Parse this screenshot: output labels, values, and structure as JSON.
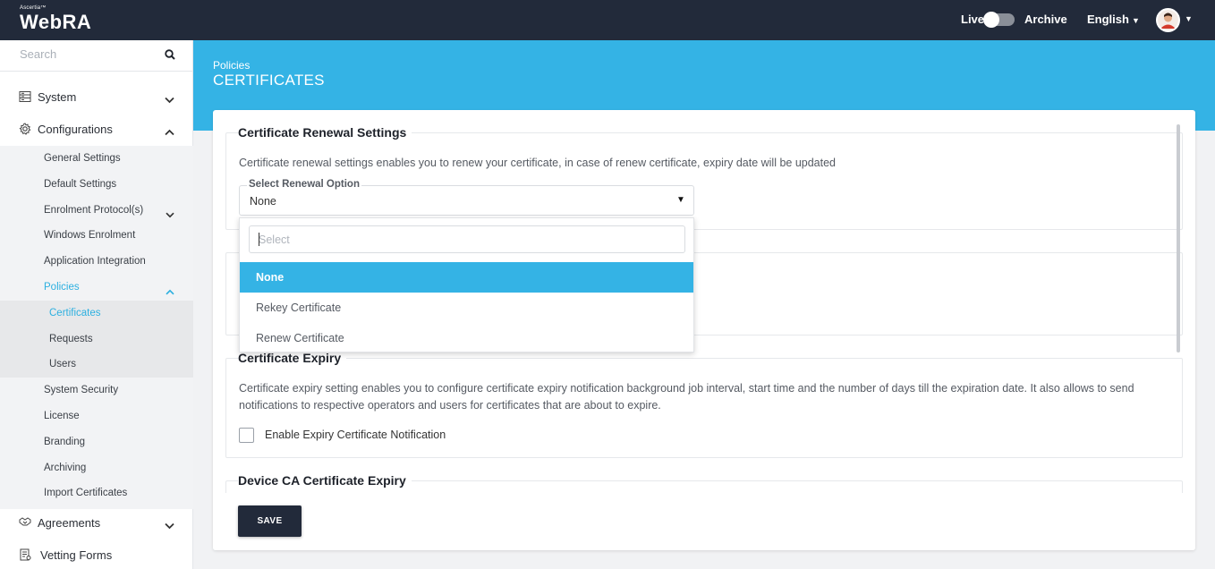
{
  "header": {
    "brand_sup": "Ascertia™",
    "brand": "WebRA",
    "live_label": "Live",
    "archive_label": "Archive",
    "language": "English"
  },
  "sidebar": {
    "search_placeholder": "Search",
    "system": "System",
    "configurations": "Configurations",
    "config_items": [
      "General Settings",
      "Default Settings",
      "Enrolment Protocol(s)",
      "Windows Enrolment",
      "Application Integration",
      "Policies"
    ],
    "policy_items": [
      "Certificates",
      "Requests",
      "Users"
    ],
    "more_items": [
      "System Security",
      "License",
      "Branding",
      "Archiving",
      "Import Certificates"
    ],
    "agreements": "Agreements",
    "vetting_forms": "Vetting Forms"
  },
  "main": {
    "breadcrumb": "Policies",
    "title": "CERTIFICATES",
    "renewal": {
      "title": "Certificate Renewal Settings",
      "description": "Certificate renewal settings enables you to renew your certificate, in case of renew certificate, expiry date will be updated",
      "select_label": "Select Renewal Option",
      "select_value": "None",
      "search_placeholder": "Select",
      "options": [
        "None",
        "Rekey Certificate",
        "Renew Certificate"
      ]
    },
    "expiry": {
      "title": "Certificate Expiry",
      "description": "Certificate expiry setting enables you to configure certificate expiry notification background job interval, start time and the number of days till the expiration date. It also allows to send notifications to respective operators and users for certificates that are about to expire.",
      "checkbox_label": "Enable Expiry Certificate Notification"
    },
    "device_ca": {
      "title": "Device CA Certificate Expiry"
    },
    "save_label": "SAVE"
  },
  "colors": {
    "topbar": "#222a3a",
    "accent": "#34b3e5",
    "active_text": "#2db0e0"
  }
}
